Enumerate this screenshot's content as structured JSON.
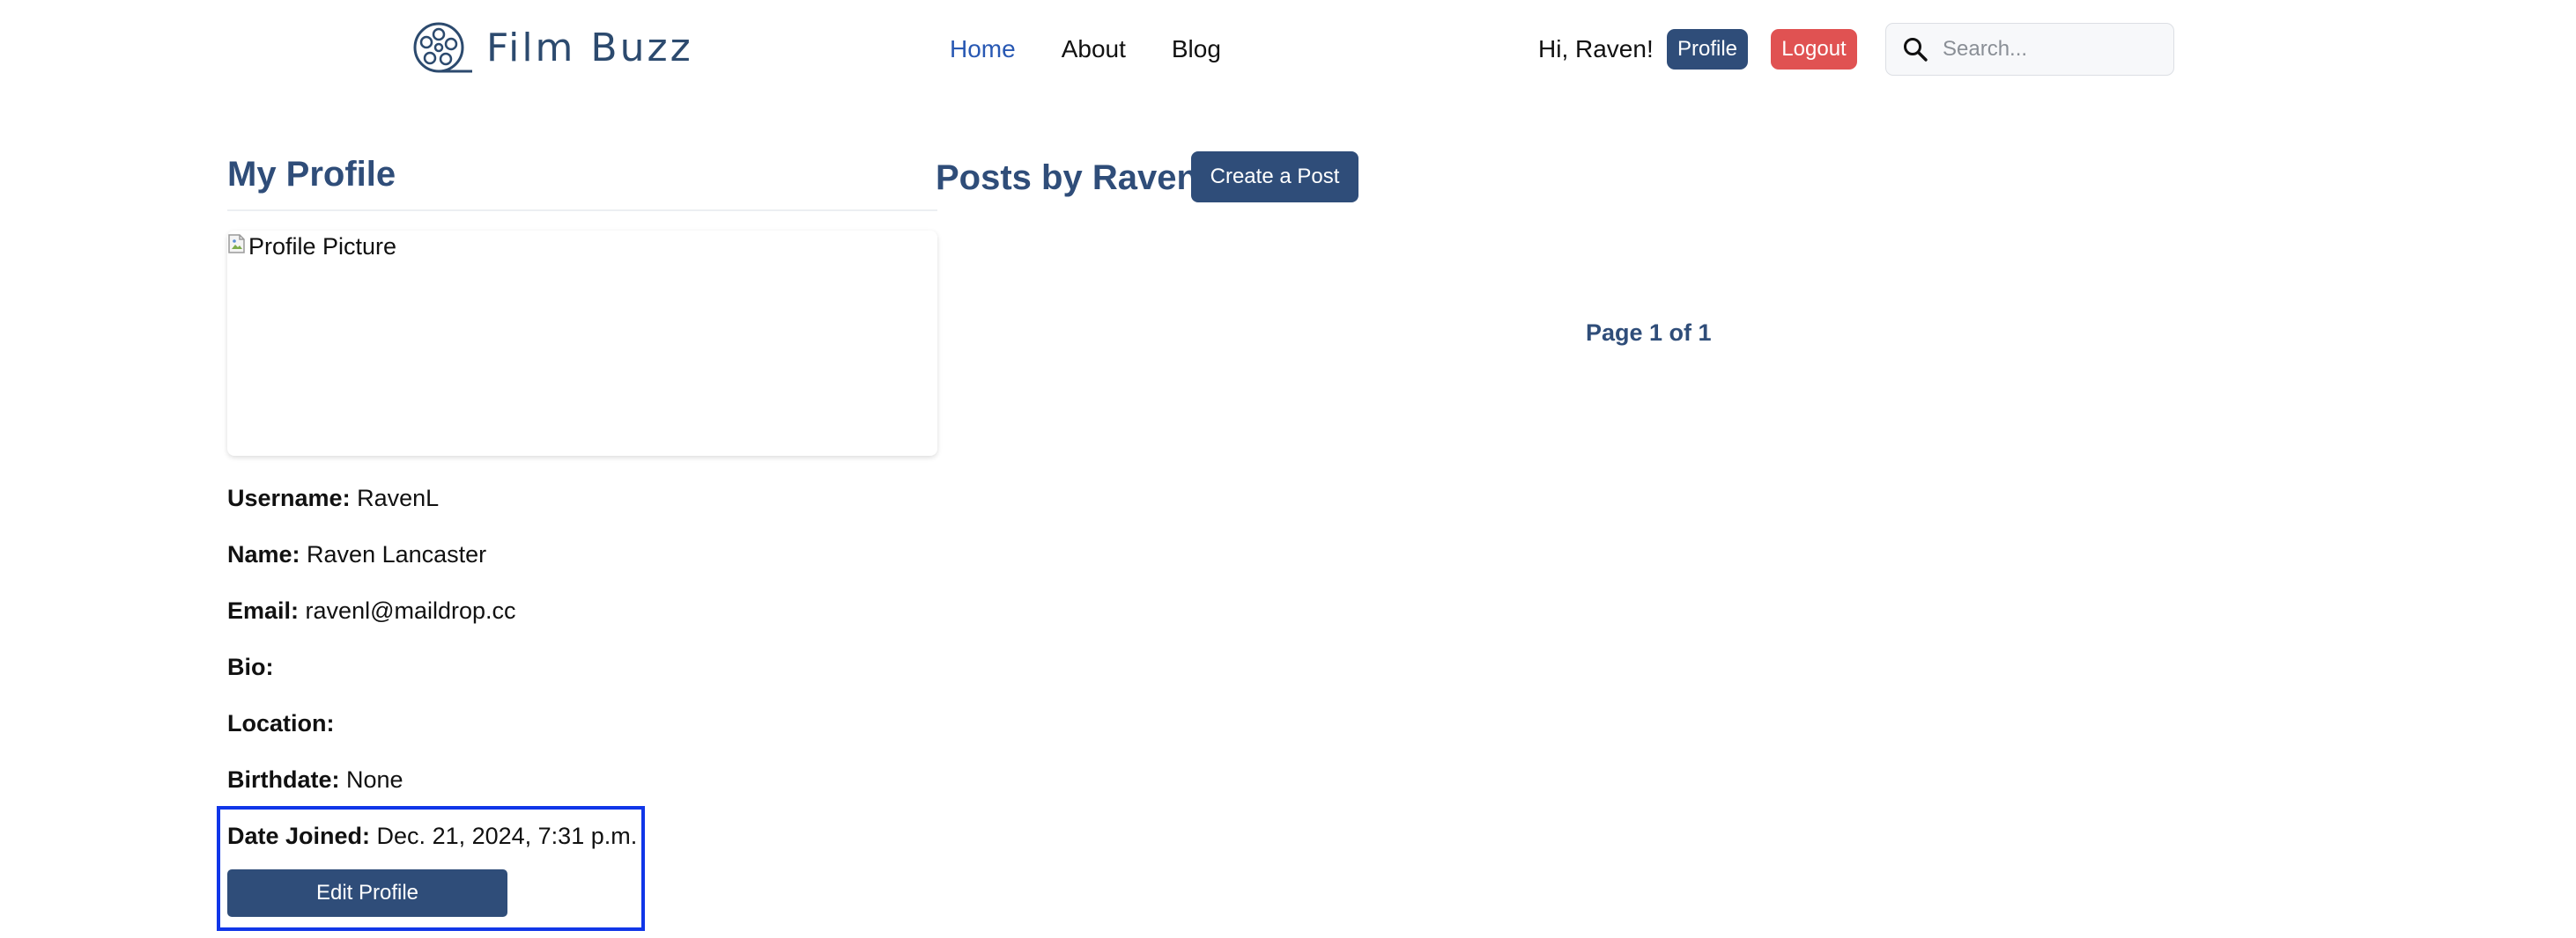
{
  "navbar": {
    "brand": "Film Buzz",
    "links": [
      "Home",
      "About",
      "Blog"
    ],
    "active_link": "Home",
    "greeting": "Hi, Raven!",
    "profile_button": "Profile",
    "logout_button": "Logout",
    "search_placeholder": "Search..."
  },
  "profile": {
    "title": "My Profile",
    "picture_alt": "Profile Picture",
    "fields": {
      "username": {
        "label": "Username:",
        "value": "RavenL"
      },
      "name": {
        "label": "Name:",
        "value": "Raven Lancaster"
      },
      "email": {
        "label": "Email:",
        "value": "ravenl@maildrop.cc"
      },
      "bio": {
        "label": "Bio:",
        "value": ""
      },
      "location": {
        "label": "Location:",
        "value": ""
      },
      "birthdate": {
        "label": "Birthdate:",
        "value": "None"
      },
      "date_joined": {
        "label": "Date Joined:",
        "value": "Dec. 21, 2024, 7:31 p.m."
      }
    },
    "edit_button": "Edit Profile"
  },
  "posts": {
    "title": "Posts by Raven",
    "create_button": "Create a Post",
    "pagination": "Page 1 of 1"
  },
  "colors": {
    "primary": "#2f4d79",
    "link_active": "#2858b3",
    "logout": "#e05252",
    "highlight": "#1036e8"
  }
}
